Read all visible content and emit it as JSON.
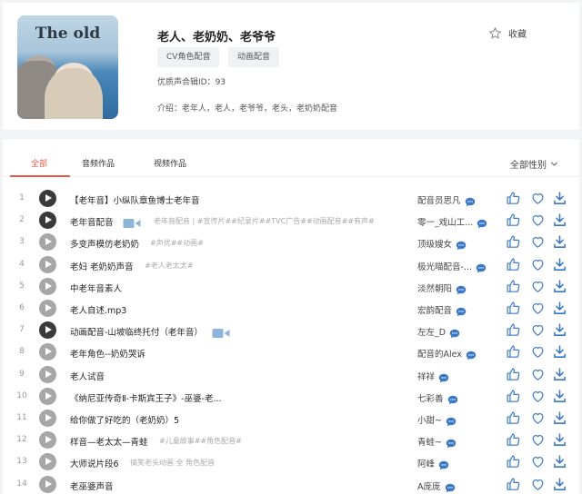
{
  "album": {
    "cover_text": "The old",
    "title": "老人、老奶奶、老爷爷",
    "tags": [
      "CV角色配音",
      "动画配音"
    ],
    "id_line": "优质声合辑ID：93",
    "intro_line": "介绍：老年人，老人，老爷爷，老头，老奶奶配音",
    "favorite_label": "收藏"
  },
  "tabs": {
    "items": [
      "全部",
      "音频作品",
      "视频作品"
    ],
    "active": "全部",
    "gender_filter": "全部性别"
  },
  "colors": {
    "accent": "#e8584a",
    "icon_blue": "#3b78c3"
  },
  "rows": [
    {
      "num": "1",
      "title": "【老年音】小纵队章鱼博士老年音",
      "video": false,
      "desc": "",
      "artist": "配音员思凡",
      "play": "dark"
    },
    {
      "num": "2",
      "title": "老年音配音",
      "video": true,
      "desc": "老年音配音 | #宣传片##纪录片##TVC广告##动画配音##有声#",
      "artist": "零一_戏山工...",
      "play": "dark"
    },
    {
      "num": "3",
      "title": "多变声模仿老奶奶",
      "video": false,
      "desc": "#声优##动画#",
      "artist": "顶级嫂女",
      "play": "light"
    },
    {
      "num": "4",
      "title": "老妇 老奶奶声音",
      "video": false,
      "desc": "#老人老太太#",
      "artist": "极光喵配音-...",
      "play": "light"
    },
    {
      "num": "5",
      "title": "中老年音素人",
      "video": false,
      "desc": "",
      "artist": "淡然朝阳",
      "play": "light"
    },
    {
      "num": "6",
      "title": "老人自述.mp3",
      "video": false,
      "desc": "",
      "artist": "宏韵配音",
      "play": "light"
    },
    {
      "num": "7",
      "title": "动画配音-山坡临终托付（老年音）",
      "video": true,
      "desc": "",
      "artist": "左左_D",
      "play": "dark"
    },
    {
      "num": "8",
      "title": "老年角色--奶奶哭诉",
      "video": false,
      "desc": "",
      "artist": "配音的Alex",
      "play": "light"
    },
    {
      "num": "9",
      "title": "老人试音",
      "video": false,
      "desc": "",
      "artist": "祥祥",
      "play": "light"
    },
    {
      "num": "10",
      "title": "《纳尼亚传奇Ⅱ-卡斯宾王子》-巫婆-老...",
      "video": false,
      "desc": "",
      "artist": "七彩善",
      "play": "light"
    },
    {
      "num": "11",
      "title": "给你做了好吃的（老奶奶）5",
      "video": false,
      "desc": "",
      "artist": "小甜~",
      "play": "light"
    },
    {
      "num": "12",
      "title": "样音—老太太—青蛙",
      "video": false,
      "desc": "#儿童故事##角色配音#",
      "artist": "青蛙~",
      "play": "light"
    },
    {
      "num": "13",
      "title": "大师说片段6",
      "video": false,
      "desc": "搞笑老头动画 全 角色配音",
      "artist": "阿峰",
      "play": "light"
    },
    {
      "num": "14",
      "title": "老巫婆声音",
      "video": false,
      "desc": "",
      "artist": "A庞庞",
      "play": "light"
    }
  ]
}
